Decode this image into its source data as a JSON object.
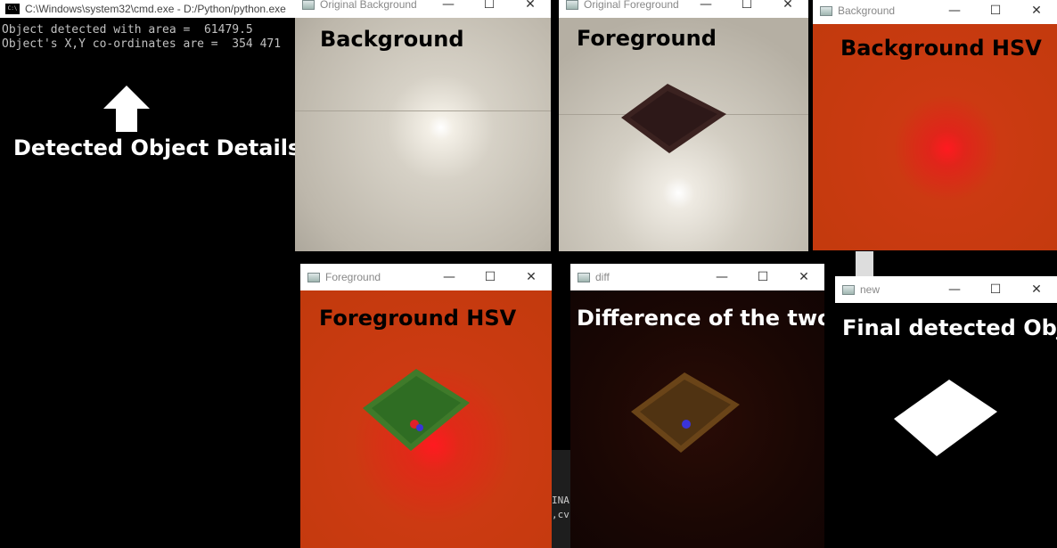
{
  "cmd": {
    "title": "C:\\Windows\\system32\\cmd.exe - D:/Python/python.exe",
    "icon": "C:\\",
    "lines": [
      "Object detected with area =  61479.5",
      "Object's X,Y co-ordinates are =  354 471"
    ],
    "annotation": "Detected Object Details",
    "bg_fragments": [
      "INA",
      ",cv."
    ]
  },
  "windows": {
    "orig_bg": {
      "title": "Original Background",
      "caption": "Background"
    },
    "orig_fg": {
      "title": "Original Foreground",
      "caption": "Foreground"
    },
    "bg_hsv": {
      "title": "Background",
      "caption": "Background HSV"
    },
    "fg_hsv": {
      "title": "Foreground",
      "caption": "Foreground HSV"
    },
    "diff": {
      "title": "diff",
      "caption": "Difference of the two"
    },
    "new": {
      "title": "new",
      "caption": "Final detected Obj"
    }
  },
  "controls": {
    "minimize": "—",
    "maximize": "☐",
    "close": "✕"
  },
  "colors": {
    "hsv_red": "#d42a10",
    "diff_dark": "#140604",
    "floor": "#cfcac0"
  }
}
